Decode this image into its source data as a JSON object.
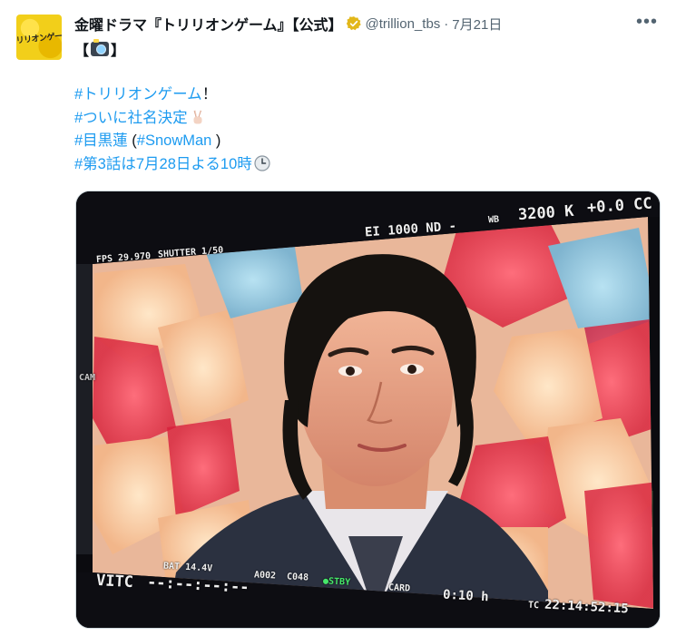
{
  "header": {
    "display_name": "金曜ドラマ『トリリオンゲーム』【公式】",
    "handle": "@trillion_tbs",
    "separator": "·",
    "date": "7月21日",
    "more_label": "•••"
  },
  "avatar": {
    "logo_text": "トリリオンゲーム"
  },
  "line2": {
    "open": "【",
    "close": "】"
  },
  "tweet": {
    "row1_hashtag": "#トリリオンゲーム",
    "row1_suffix": "！",
    "row2_hashtag": "#ついに社名決定",
    "row3_hashtag": "#目黒蓮",
    "row3_open": " (",
    "row3_hashtag2": "#SnowMan",
    "row3_close": " )",
    "row4_hashtag": "#第3話は7月28日よる10時"
  },
  "monitor": {
    "ei": "EI 1000 ND -",
    "wb": "WB",
    "wb_value": "3200 K",
    "tint": "+0.0 CC",
    "fps": "FPS 29.970",
    "shutter": "SHUTTER 1/50",
    "vitc": "VITC",
    "vitc_value": "--:--:--:--",
    "bat": "BAT 14.4V",
    "clip": "A002",
    "clip_num": "C048",
    "stby": "●STBY",
    "card": "CARD",
    "card_time": "0:10 h",
    "tc": "TC",
    "tc_value": "22:14:52:15",
    "cam": "CAM"
  }
}
